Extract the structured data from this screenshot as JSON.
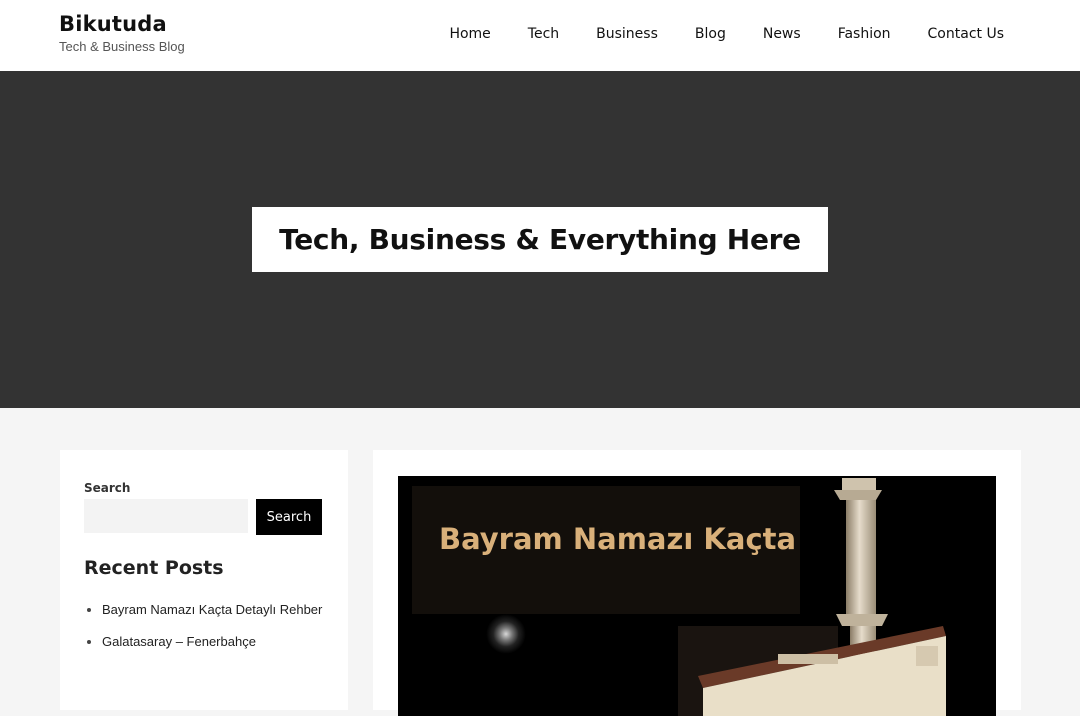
{
  "header": {
    "site_title": "Bikutuda",
    "tagline": "Tech & Business Blog",
    "nav": [
      {
        "label": "Home"
      },
      {
        "label": "Tech"
      },
      {
        "label": "Business"
      },
      {
        "label": "Blog"
      },
      {
        "label": "News"
      },
      {
        "label": "Fashion"
      },
      {
        "label": "Contact Us"
      }
    ]
  },
  "hero": {
    "title": "Tech, Business & Everything Here",
    "background_color": "#333333"
  },
  "sidebar": {
    "search_label": "Search",
    "search_placeholder": "",
    "search_button": "Search",
    "recent_title": "Recent Posts",
    "recent_posts": [
      {
        "title": "Bayram Namazı Kaçta Detaylı Rehber"
      },
      {
        "title": "Galatasaray – Fenerbahçe"
      }
    ]
  },
  "main": {
    "featured_image_text": "Bayram Namazı Kaçta",
    "accent_color": "#d9b07a"
  }
}
